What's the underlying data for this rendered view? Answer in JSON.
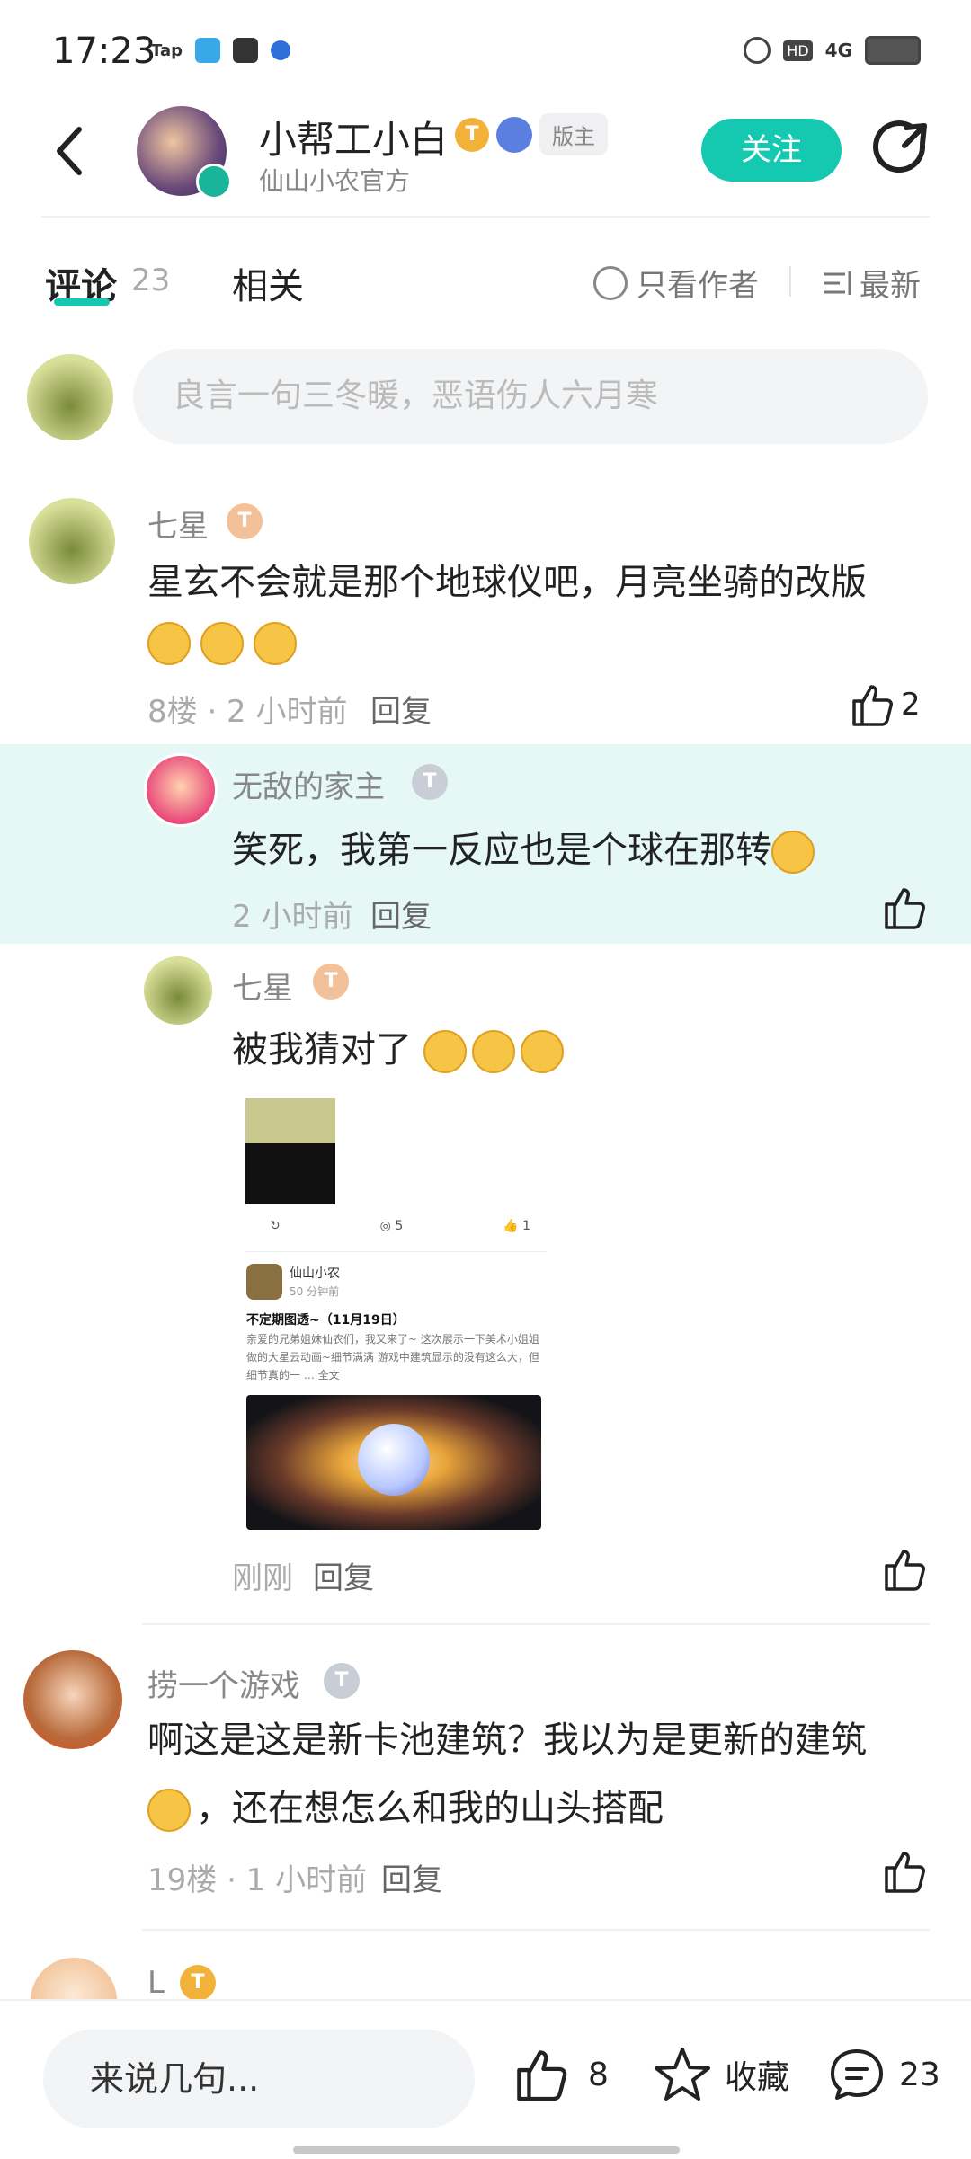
{
  "status_bar": {
    "time": "17:23",
    "app_icons": [
      "Tap"
    ],
    "network": "4G",
    "hd": "HD"
  },
  "header": {
    "title": "小帮工小白",
    "subtitle": "仙山小农官方",
    "level_badge": "T",
    "mod_tag": "版主",
    "follow_label": "关注"
  },
  "tabs": {
    "comments_label": "评论",
    "comments_count": "23",
    "related_label": "相关",
    "only_author_label": "只看作者",
    "sort_label": "最新"
  },
  "comment_input": {
    "placeholder": "良言一句三冬暖，恶语伤人六月寒"
  },
  "comments": [
    {
      "name": "七星",
      "level": "T",
      "text": "星玄不会就是那个地球仪吧，月亮坐骑的改版",
      "meta": "8楼 · 2 小时前",
      "reply": "回复",
      "likes": "2"
    },
    {
      "name": "无敌的家主",
      "level": "T",
      "text": "笑死，我第一反应也是个球在那转",
      "meta": "2 小时前",
      "reply": "回复"
    },
    {
      "name": "七星",
      "level": "T",
      "text": "被我猜对了",
      "meta": "刚刚",
      "reply": "回复"
    },
    {
      "name": "捞一个游戏",
      "level": "T",
      "text": "啊这是这是新卡池建筑？我以为是更新的建筑",
      "text2": "，还在想怎么和我的山头搭配",
      "meta": "19楼 · 1 小时前",
      "reply": "回复"
    },
    {
      "name": "L",
      "level": "T"
    }
  ],
  "screenshot": {
    "shares": "",
    "comments": "5",
    "likes": "1",
    "author": "仙山小农",
    "time": "50 分钟前",
    "post_title": "不定期图透~（11月19日）",
    "body": "亲爱的兄弟姐妹仙农们，我又来了~ 这次展示一下美术小姐姐做的大星云动画~细节满满 游戏中建筑显示的没有这么大，但细节真的一 … 全文"
  },
  "bottom_bar": {
    "input_label": "来说几句...",
    "like_count": "8",
    "fav_label": "收藏",
    "comment_count": "23"
  },
  "colors": {
    "accent": "#14c9b0",
    "highlight": "#e6f8f6"
  }
}
